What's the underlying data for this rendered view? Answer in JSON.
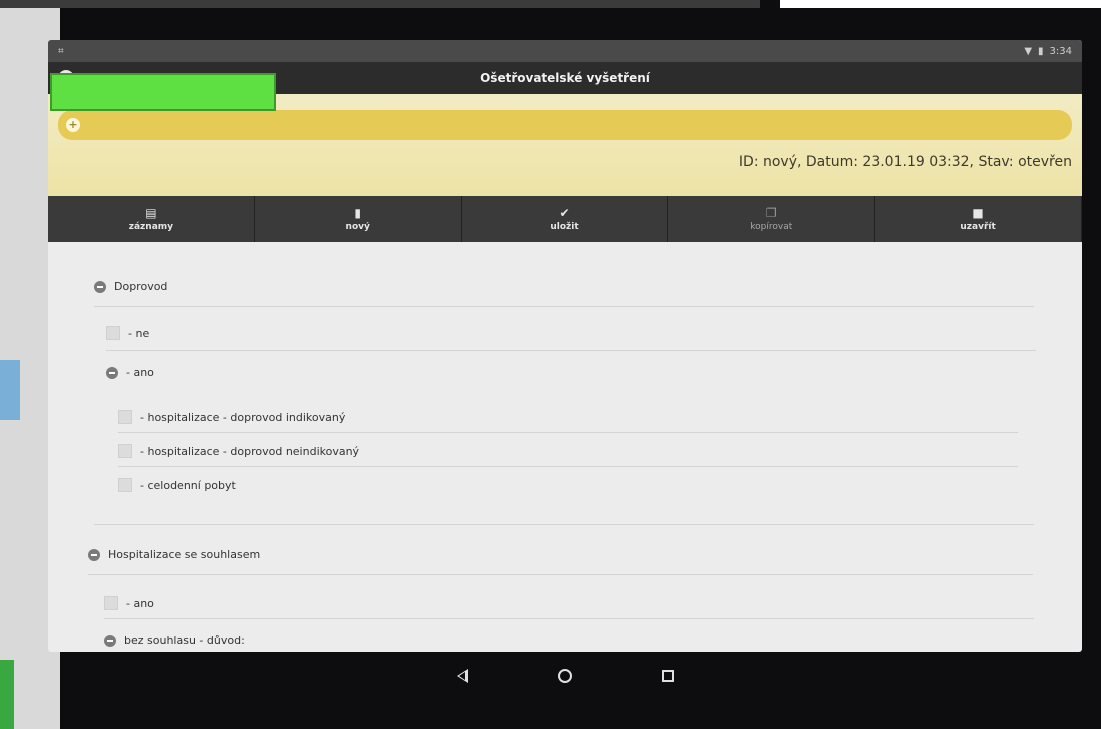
{
  "statusbar": {
    "left_icon": "menu-icon",
    "time": "3:34"
  },
  "header": {
    "title": "Ošetřovatelské vyšetření"
  },
  "patient": {
    "add_label": "+",
    "info": "ID: nový, Datum: 23.01.19 03:32, Stav: otevřen"
  },
  "toolbar": [
    {
      "label": "záznamy",
      "icon": "list-icon",
      "glyph": "▤"
    },
    {
      "label": "nový",
      "icon": "new-document-icon",
      "glyph": "▮"
    },
    {
      "label": "uložit",
      "icon": "check-icon",
      "glyph": "✔"
    },
    {
      "label": "kopírovat",
      "icon": "copy-icon",
      "glyph": "❐"
    },
    {
      "label": "uzavřít",
      "icon": "lock-icon",
      "glyph": "🔒"
    }
  ],
  "form": {
    "doprovod": "Doprovod",
    "ne": "- ne",
    "ano": "- ano",
    "hosp_indikovany": "- hospitalizace - doprovod indikovaný",
    "hosp_neindikovany": "- hospitalizace - doprovod neindikovaný",
    "celodenni": "- celodenní pobyt",
    "hosp_souhlas": "Hospitalizace se souhlasem",
    "souhlas_ano": "- ano",
    "bez_souhlasu": "bez souhlasu - důvod:"
  }
}
